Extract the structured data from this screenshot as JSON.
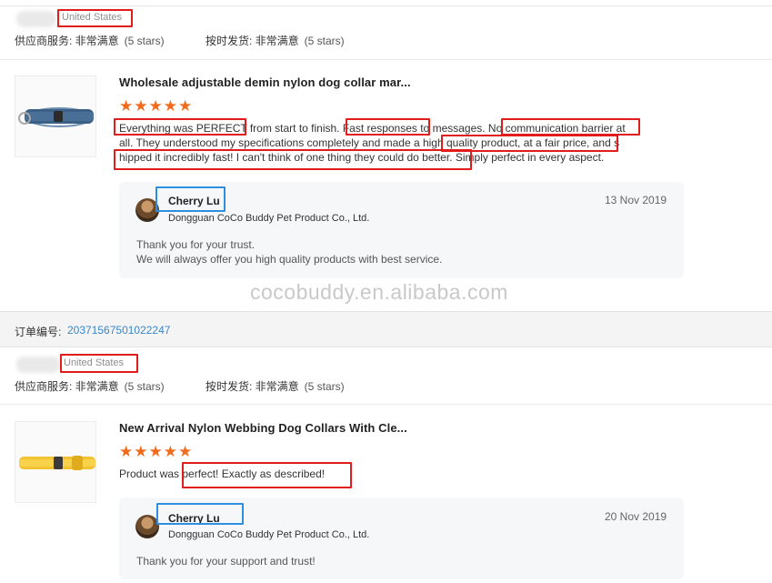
{
  "reviews": [
    {
      "country": "United States",
      "supplier_service_label": "供应商服务: 非常满意",
      "supplier_service_stars": "(5 stars)",
      "on_time_label": "按时发货: 非常满意",
      "on_time_stars": "(5 stars)",
      "product_title": "Wholesale adjustable demin nylon dog collar mar...",
      "star_rating": 5,
      "stars_glyph": "★★★★★",
      "review_lines": [
        "Everything was PERFECT from start to finish. Fast responses to messages. No communication barrier at",
        " all. They understood my specifications completely and made a high quality product, at a fair price, and s",
        "hipped it incredibly fast! I can't think of one thing they could do better. Simply perfect in every aspect."
      ],
      "reply": {
        "name": "Cherry Lu",
        "company": "Dongguan CoCo Buddy Pet Product Co., Ltd.",
        "date": "13 Nov 2019",
        "lines": [
          "Thank you for your trust.",
          "We will always offer you high quality products with best service."
        ]
      }
    },
    {
      "country": "United States",
      "supplier_service_label": "供应商服务: 非常满意",
      "supplier_service_stars": "(5 stars)",
      "on_time_label": "按时发货: 非常满意",
      "on_time_stars": "(5 stars)",
      "product_title": "New Arrival Nylon Webbing Dog Collars With Cle...",
      "star_rating": 5,
      "stars_glyph": "★★★★★",
      "review_lines": [
        "Product was perfect! Exactly as described!"
      ],
      "reply": {
        "name": "Cherry Lu",
        "company": "Dongguan CoCo Buddy Pet Product Co., Ltd.",
        "date": "20 Nov 2019",
        "lines": [
          "Thank you for your support and trust!"
        ]
      }
    }
  ],
  "order": {
    "label": "订单编号:",
    "number": "20371567501022247"
  },
  "watermark": "cocobuddy.en.alibaba.com",
  "colors": {
    "star": "#f26b1d",
    "highlight_red": "#e21b1b",
    "highlight_blue": "#2e8fe0",
    "order_link": "#3a86c8"
  }
}
